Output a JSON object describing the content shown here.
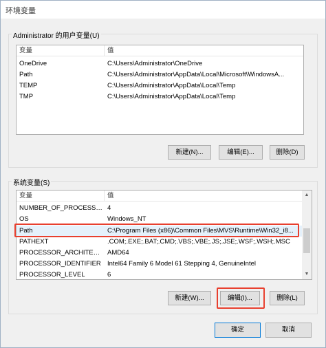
{
  "window": {
    "title": "环境变量"
  },
  "user_vars": {
    "label": "Administrator 的用户变量(U)",
    "columns": [
      "变量",
      "值"
    ],
    "rows": [
      {
        "name": "OneDrive",
        "value": "C:\\Users\\Administrator\\OneDrive"
      },
      {
        "name": "Path",
        "value": "C:\\Users\\Administrator\\AppData\\Local\\Microsoft\\WindowsA..."
      },
      {
        "name": "TEMP",
        "value": "C:\\Users\\Administrator\\AppData\\Local\\Temp"
      },
      {
        "name": "TMP",
        "value": "C:\\Users\\Administrator\\AppData\\Local\\Temp"
      }
    ],
    "buttons": {
      "new": "新建(N)...",
      "edit": "编辑(E)...",
      "delete": "删除(D)"
    }
  },
  "system_vars": {
    "label": "系统变量(S)",
    "columns": [
      "变量",
      "值"
    ],
    "rows": [
      {
        "name": "NUMBER_OF_PROCESSORS",
        "value": "4"
      },
      {
        "name": "OS",
        "value": "Windows_NT"
      },
      {
        "name": "Path",
        "value": "C:\\Program Files (x86)\\Common Files\\MVS\\Runtime\\Win32_i8..."
      },
      {
        "name": "PATHEXT",
        "value": ".COM;.EXE;.BAT;.CMD;.VBS;.VBE;.JS;.JSE;.WSF;.WSH;.MSC"
      },
      {
        "name": "PROCESSOR_ARCHITECT...",
        "value": "AMD64"
      },
      {
        "name": "PROCESSOR_IDENTIFIER",
        "value": "Intel64 Family 6 Model 61 Stepping 4, GenuineIntel"
      },
      {
        "name": "PROCESSOR_LEVEL",
        "value": "6"
      }
    ],
    "buttons": {
      "new": "新建(W)...",
      "edit": "编辑(I)...",
      "delete": "删除(L)"
    }
  },
  "footer": {
    "ok": "确定",
    "cancel": "取消"
  },
  "colors": {
    "highlight": "#e8402f",
    "selection": "#e5f1fb",
    "button_face": "#e1e1e1"
  }
}
